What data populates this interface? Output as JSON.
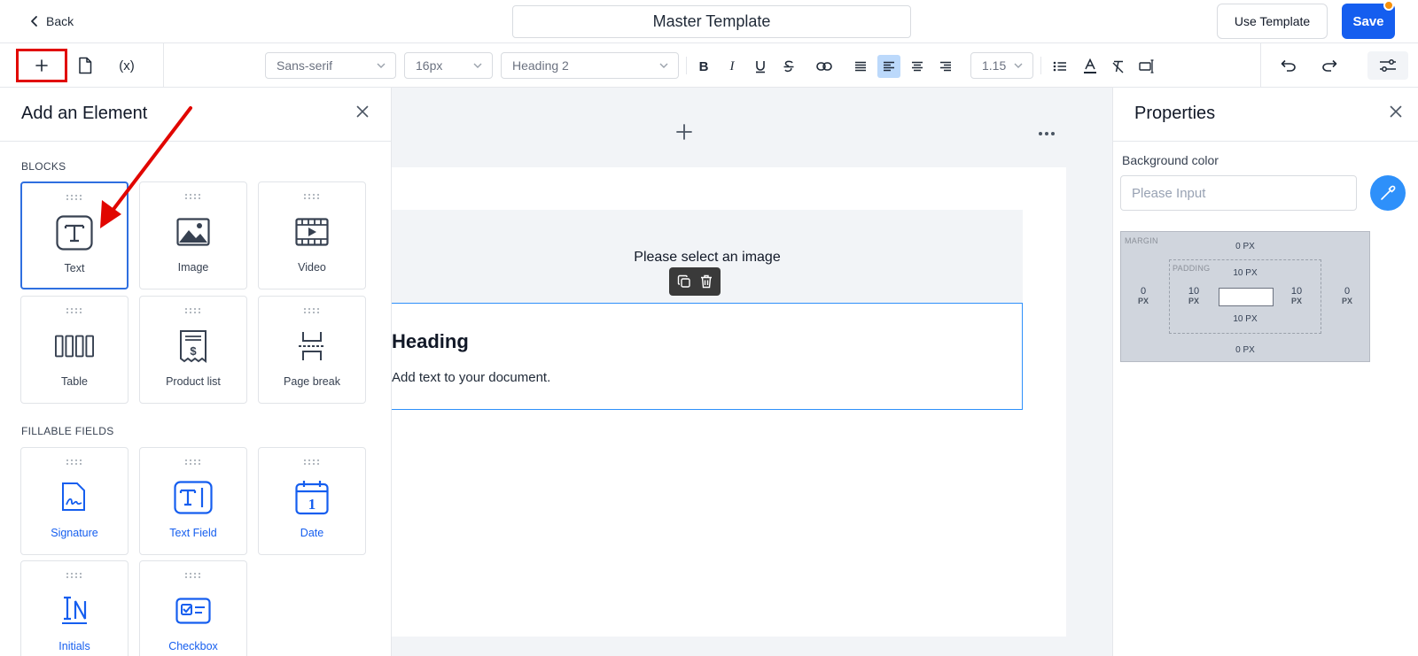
{
  "header": {
    "back_label": "Back",
    "title": "Master Template",
    "use_template_label": "Use Template",
    "save_label": "Save"
  },
  "toolbar": {
    "add_icon": "plus-icon",
    "document_icon": "document-icon",
    "variable_label": "(x)",
    "font_family": "Sans-serif",
    "font_size": "16px",
    "text_style": "Heading 2",
    "line_height": "1.15",
    "active_alignment": "align-left"
  },
  "left_panel": {
    "title": "Add an Element",
    "blocks_heading": "BLOCKS",
    "blocks": [
      {
        "label": "Text",
        "icon": "text-icon"
      },
      {
        "label": "Image",
        "icon": "image-icon"
      },
      {
        "label": "Video",
        "icon": "video-icon"
      },
      {
        "label": "Table",
        "icon": "table-icon"
      },
      {
        "label": "Product list",
        "icon": "product-list-icon"
      },
      {
        "label": "Page break",
        "icon": "page-break-icon"
      }
    ],
    "fields_heading": "FILLABLE FIELDS",
    "fields": [
      {
        "label": "Signature",
        "icon": "signature-icon"
      },
      {
        "label": "Text Field",
        "icon": "text-field-icon"
      },
      {
        "label": "Date",
        "icon": "date-icon"
      },
      {
        "label": "Initials",
        "icon": "initials-icon"
      },
      {
        "label": "Checkbox",
        "icon": "checkbox-icon"
      }
    ]
  },
  "canvas": {
    "image_placeholder": "Please select an image",
    "heading": "Heading",
    "paragraph": "Add text to your document."
  },
  "properties": {
    "title": "Properties",
    "background_label": "Background color",
    "background_placeholder": "Please Input",
    "margin_label": "MARGIN",
    "padding_label": "PADDING",
    "margin_top": "0 PX",
    "margin_bottom": "0 PX",
    "margin_left": "0",
    "margin_right": "0",
    "padding_top": "10 PX",
    "padding_bottom": "10 PX",
    "padding_left": "10",
    "padding_right": "10",
    "unit": "PX"
  },
  "colors": {
    "primary": "#155eef",
    "highlight": "#e10600",
    "selection": "#2e90fa",
    "notification": "#f79009"
  }
}
